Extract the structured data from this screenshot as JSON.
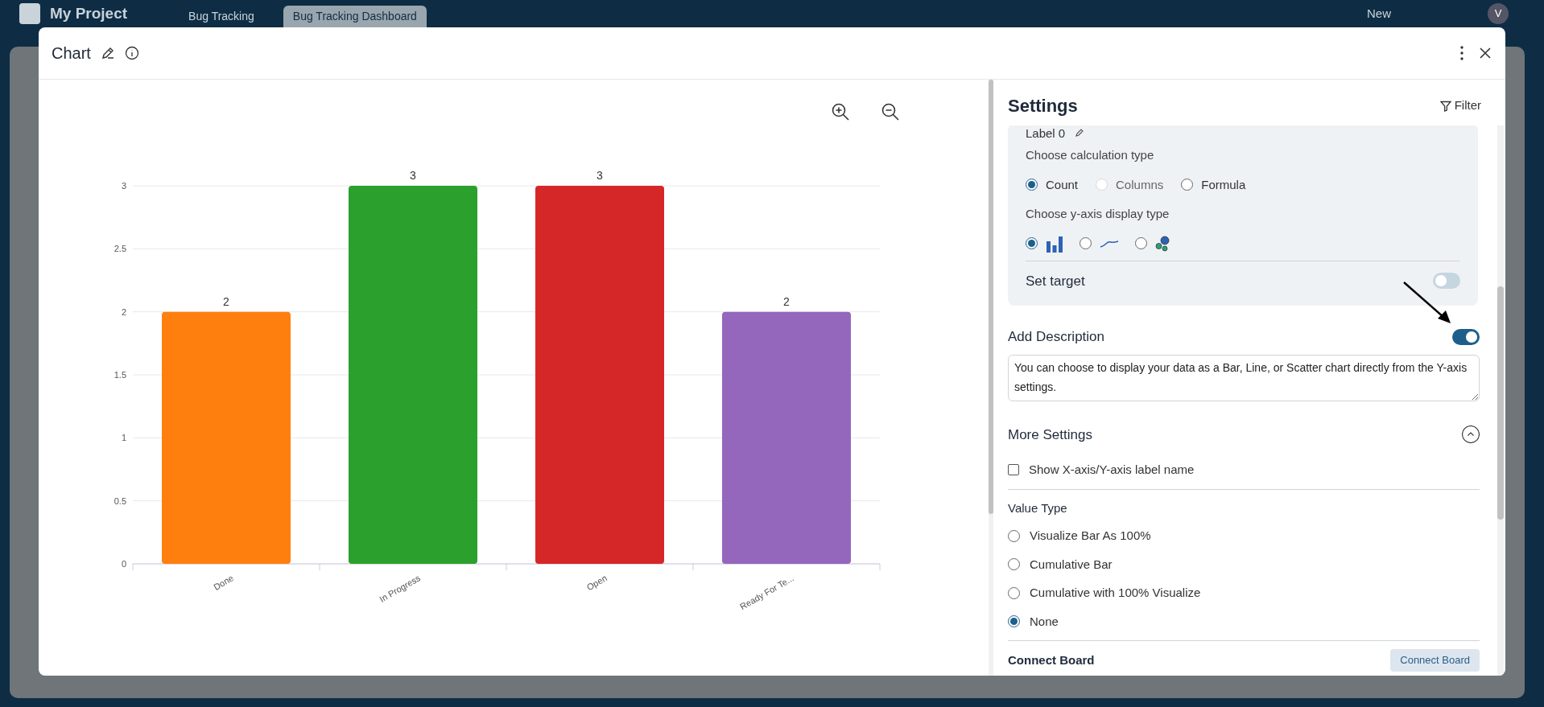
{
  "app_bar": {
    "project": "My Project",
    "tabs": [
      {
        "label": "Bug Tracking",
        "selected": false
      },
      {
        "label": "Bug Tracking Dashboard",
        "selected": true
      }
    ],
    "new_button": "New",
    "avatar": "V"
  },
  "dialog": {
    "title": "Chart"
  },
  "chart_data": {
    "type": "bar",
    "categories": [
      "Done",
      "In Progress",
      "Open",
      "Ready For Te..."
    ],
    "series": [
      {
        "color": [
          "#ff7f0e",
          "#2ca02c",
          "#d62728",
          "#9467bd"
        ],
        "values": [
          2,
          3,
          3,
          2
        ]
      }
    ],
    "grid": true,
    "ylim": [
      0,
      3
    ],
    "yticks": [
      0,
      0.5,
      1,
      1.5,
      2,
      2.5,
      3
    ],
    "data_labels": true
  },
  "settings": {
    "title": "Settings",
    "filter": "Filter",
    "label": "Label 0",
    "calc_title": "Choose calculation type",
    "calc_options": [
      {
        "label": "Count",
        "selected": true,
        "disabled": false
      },
      {
        "label": "Columns",
        "selected": false,
        "disabled": true
      },
      {
        "label": "Formula",
        "selected": false,
        "disabled": false
      }
    ],
    "yaxis_title": "Choose y-axis display type",
    "yaxis_options": [
      {
        "kind": "bar",
        "selected": true
      },
      {
        "kind": "line",
        "selected": false
      },
      {
        "kind": "scatter",
        "selected": false
      }
    ],
    "set_target": {
      "label": "Set target",
      "on": false
    },
    "description": {
      "label": "Add Description",
      "on": true,
      "value": "You can choose to display your data as a Bar, Line, or Scatter chart directly from the Y-axis settings."
    },
    "more_settings": {
      "title": "More Settings",
      "expanded": true,
      "show_axis_label": {
        "label": "Show X-axis/Y-axis label name",
        "checked": false
      },
      "value_type_title": "Value Type",
      "value_types": [
        {
          "label": "Visualize Bar As 100%",
          "selected": false
        },
        {
          "label": "Cumulative Bar",
          "selected": false
        },
        {
          "label": "Cumulative with 100% Visualize",
          "selected": false
        },
        {
          "label": "None",
          "selected": true
        }
      ],
      "connect_board": {
        "label": "Connect Board",
        "button": "Connect Board"
      }
    }
  }
}
